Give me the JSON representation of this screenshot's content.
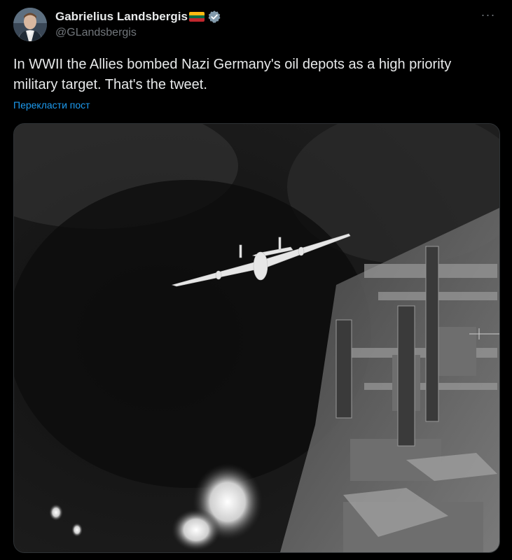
{
  "author": {
    "display_name": "Gabrielius Landsbergis",
    "handle": "@GLandsbergis",
    "flag_icon": "lithuania-flag-icon",
    "verified_icon": "verified-badge-icon"
  },
  "tweet": {
    "text": "In WWII the Allies bombed Nazi Germany's oil depots as a high priority military target. That's the tweet.",
    "translate_label": "Перекласти пост"
  },
  "more_menu_label": "···",
  "colors": {
    "background": "#000000",
    "text": "#e7e9ea",
    "secondary": "#71767b",
    "link": "#1d9bf0",
    "flag_yellow": "#fdb913",
    "flag_green": "#006a44",
    "flag_red": "#c1272d"
  },
  "media": {
    "icon": "photo-image",
    "alt": "Black-and-white aerial photo of a bomber flying over a burning oil refinery"
  }
}
